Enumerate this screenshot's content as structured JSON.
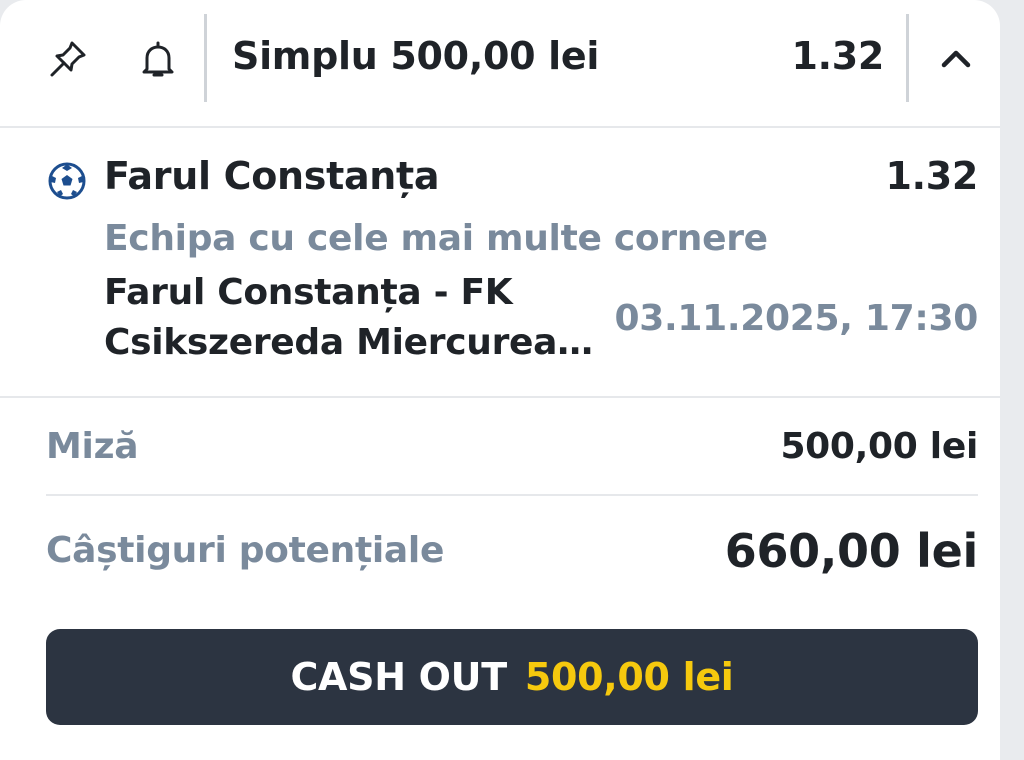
{
  "header": {
    "title": "Simplu 500,00 lei",
    "odds": "1.32",
    "icons": [
      "pin-icon",
      "bell-icon",
      "chevron-up-icon"
    ]
  },
  "selection": {
    "sport_icon": "soccer-ball-icon",
    "team": "Farul Constanța",
    "odds": "1.32",
    "market": "Echipa cu cele mai multe cornere",
    "event": "Farul Constanța - FK Csikszereda Miercurea…",
    "datetime": "03.11.2025, 17:30"
  },
  "stake": {
    "label": "Miză",
    "value": "500,00 lei"
  },
  "winnings": {
    "label": "Câștiguri potențiale",
    "value": "660,00 lei"
  },
  "cashout": {
    "label": "CASH OUT",
    "amount": "500,00 lei"
  },
  "colors": {
    "text_dark": "#1f2328",
    "text_muted": "#7a8a9c",
    "button_bg": "#2c3441",
    "accent_yellow": "#f6c90e",
    "ball_blue": "#1d4e8f"
  }
}
